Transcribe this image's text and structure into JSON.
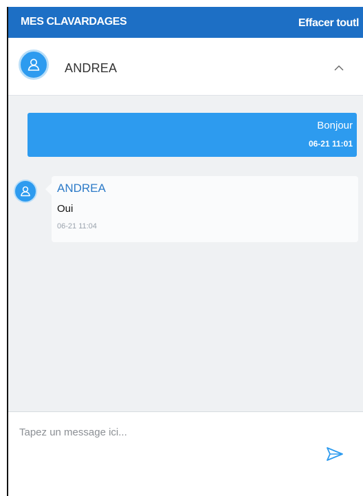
{
  "header": {
    "title": "MES CLAVARDAGES",
    "clear_label": "Effacer toutl"
  },
  "contact": {
    "name": "ANDREA",
    "avatar_icon": "user-icon",
    "toggle_icon": "chevron-up-icon"
  },
  "messages": [
    {
      "direction": "outgoing",
      "text": "Bonjour",
      "time": "06-21 11:01"
    },
    {
      "direction": "incoming",
      "sender": "ANDREA",
      "text": "Oui",
      "time": "06-21 11:04"
    }
  ],
  "composer": {
    "value": "",
    "placeholder": "Tapez un message ici...",
    "send_icon": "send-icon"
  },
  "colors": {
    "header_bg": "#1d6fc5",
    "accent": "#2d9bef",
    "panel_bg": "#eff1f3",
    "sender_name": "#2d7bc8"
  }
}
